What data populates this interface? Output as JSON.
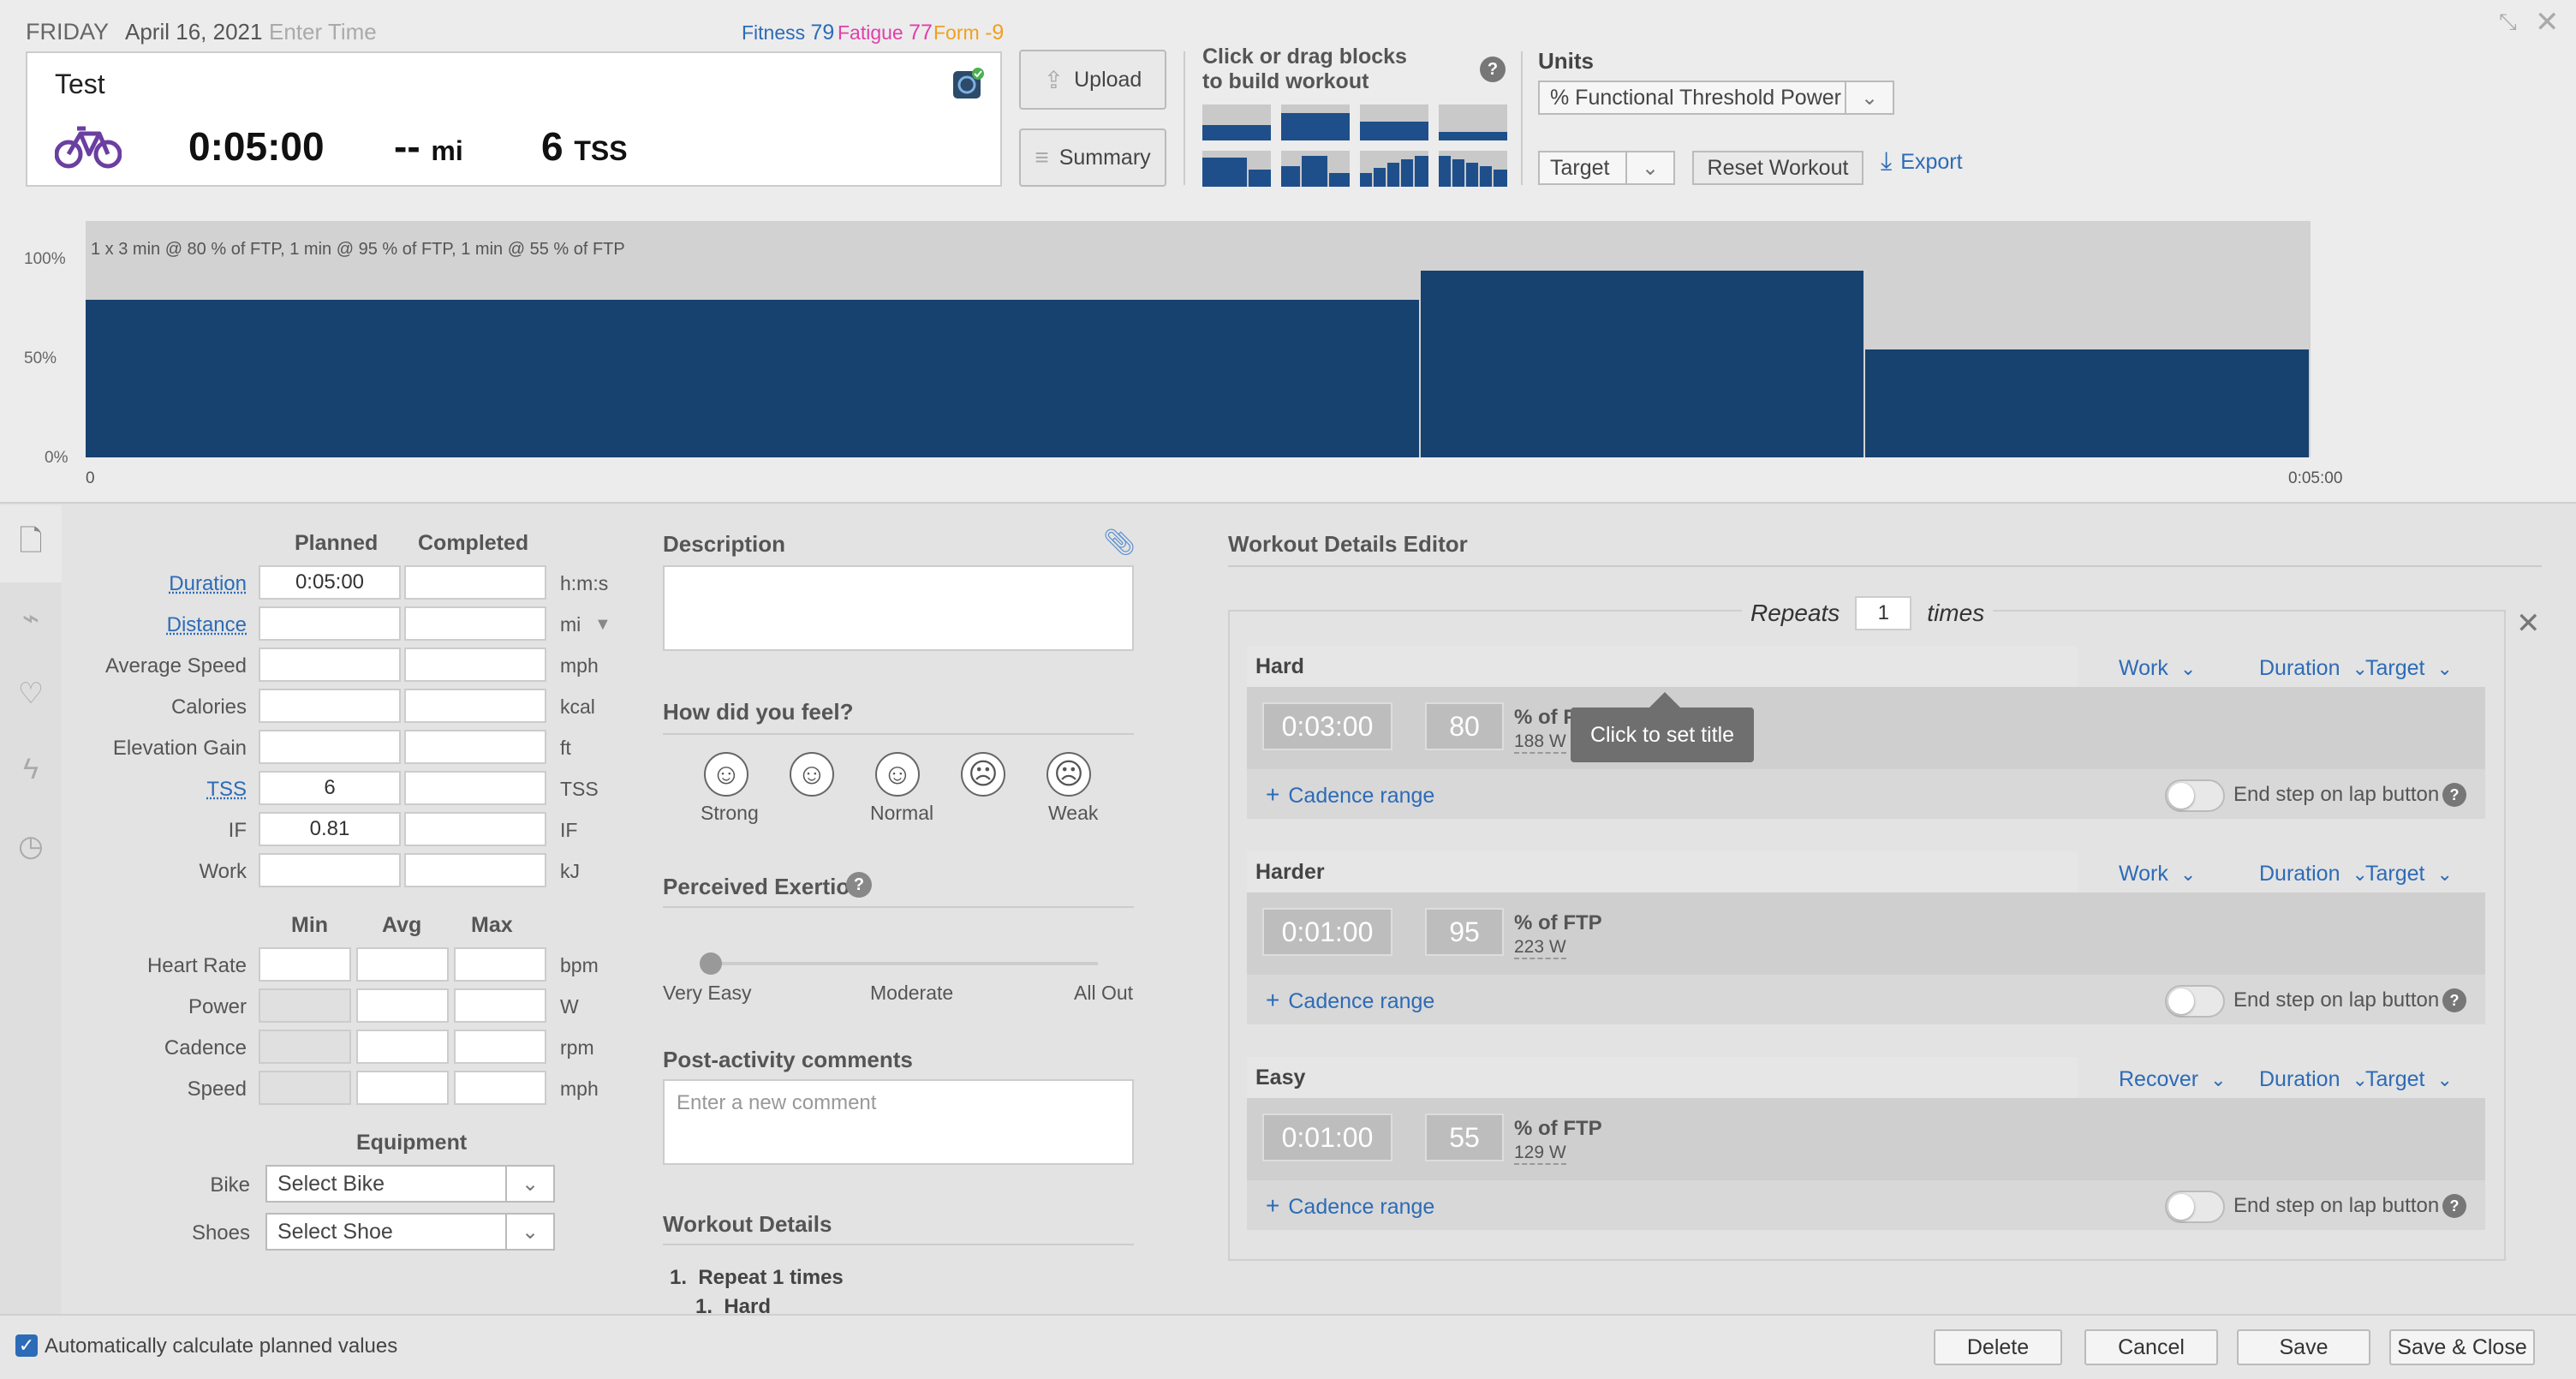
{
  "header": {
    "day": "FRIDAY",
    "date": "April 16, 2021",
    "time_placeholder": "Enter Time",
    "fitness_label": "Fitness",
    "fitness_value": "79",
    "fatigue_label": "Fatigue",
    "fatigue_value": "77",
    "form_label": "Form",
    "form_value": "-9",
    "colors": {
      "fitness": "#2c6bb7",
      "fatigue": "#e040a8",
      "form": "#f0a020"
    }
  },
  "workout_card": {
    "title": "Test",
    "sport_icon": "bike-icon",
    "duration": "0:05:00",
    "distance": "--",
    "distance_unit": "mi",
    "tss": "6",
    "tss_unit": "TSS"
  },
  "toolbar": {
    "upload_label": "Upload",
    "summary_label": "Summary",
    "builder_label_1": "Click or drag blocks",
    "builder_label_2": "to build workout",
    "help": "?",
    "units_label": "Units",
    "units_value": "% Functional Threshold Power",
    "target_value": "Target",
    "reset_label": "Reset Workout",
    "export_label": "Export"
  },
  "chart_data": {
    "type": "bar",
    "description": "1 x 3 min @ 80 % of FTP, 1 min @ 95 % of FTP, 1 min @ 55 % of FTP",
    "y_ticks": [
      "100%",
      "50%",
      "0%"
    ],
    "x_ticks": [
      "0",
      "0:05:00"
    ],
    "x_range_minutes": [
      0,
      5
    ],
    "ylim": [
      0,
      115
    ],
    "segments": [
      {
        "start_min": 0,
        "end_min": 3,
        "value": 80
      },
      {
        "start_min": 3,
        "end_min": 4,
        "value": 95
      },
      {
        "start_min": 4,
        "end_min": 5,
        "value": 55
      }
    ],
    "bar_color": "#17416e"
  },
  "stats": {
    "planned_header": "Planned",
    "completed_header": "Completed",
    "rows": [
      {
        "label": "Duration",
        "planned": "0:05:00",
        "unit": "h:m:s"
      },
      {
        "label": "Distance",
        "planned": "",
        "unit": "mi"
      },
      {
        "label": "Average Speed",
        "planned": "",
        "unit": "mph"
      },
      {
        "label": "Calories",
        "planned": "",
        "unit": "kcal"
      },
      {
        "label": "Elevation Gain",
        "planned": "",
        "unit": "ft"
      },
      {
        "label": "TSS",
        "planned": "6",
        "unit": "TSS"
      },
      {
        "label": "IF",
        "planned": "0.81",
        "unit": "IF"
      },
      {
        "label": "Work",
        "planned": "",
        "unit": "kJ"
      }
    ],
    "min_header": "Min",
    "avg_header": "Avg",
    "max_header": "Max",
    "range_rows": [
      {
        "label": "Heart Rate",
        "unit": "bpm"
      },
      {
        "label": "Power",
        "unit": "W"
      },
      {
        "label": "Cadence",
        "unit": "rpm"
      },
      {
        "label": "Speed",
        "unit": "mph"
      }
    ],
    "equipment_title": "Equipment",
    "bike_label": "Bike",
    "bike_value": "Select Bike",
    "shoes_label": "Shoes",
    "shoes_value": "Select Shoe"
  },
  "middle": {
    "description_title": "Description",
    "feel_title": "How did you feel?",
    "feel_strong": "Strong",
    "feel_normal": "Normal",
    "feel_weak": "Weak",
    "exertion_title": "Perceived Exertion",
    "exertion_easy": "Very Easy",
    "exertion_moderate": "Moderate",
    "exertion_allout": "All Out",
    "exertion_value": 0,
    "comments_title": "Post-activity comments",
    "comments_placeholder": "Enter a new comment",
    "details_title": "Workout Details",
    "details_line1": "1.  Repeat 1 times",
    "details_line2": "1.  Hard"
  },
  "editor": {
    "title": "Workout Details Editor",
    "repeats_label": "Repeats",
    "repeats_value": "1",
    "times_label": "times",
    "tooltip": "Click to set title",
    "cadence_label": "Cadence range",
    "endlap_label": "End step on lap button",
    "duration_label": "Duration",
    "target_label": "Target",
    "steps": [
      {
        "name": "Hard",
        "type": "Work",
        "duration": "0:03:00",
        "pct": "80",
        "pct_label": "% of FTP",
        "watts": "188 W"
      },
      {
        "name": "Harder",
        "type": "Work",
        "duration": "0:01:00",
        "pct": "95",
        "pct_label": "% of FTP",
        "watts": "223 W"
      },
      {
        "name": "Easy",
        "type": "Recover",
        "duration": "0:01:00",
        "pct": "55",
        "pct_label": "% of FTP",
        "watts": "129 W"
      }
    ]
  },
  "footer": {
    "auto_calc_label": "Automatically calculate planned values",
    "auto_calc_checked": true,
    "delete_label": "Delete",
    "cancel_label": "Cancel",
    "save_label": "Save",
    "save_close_label": "Save & Close"
  }
}
